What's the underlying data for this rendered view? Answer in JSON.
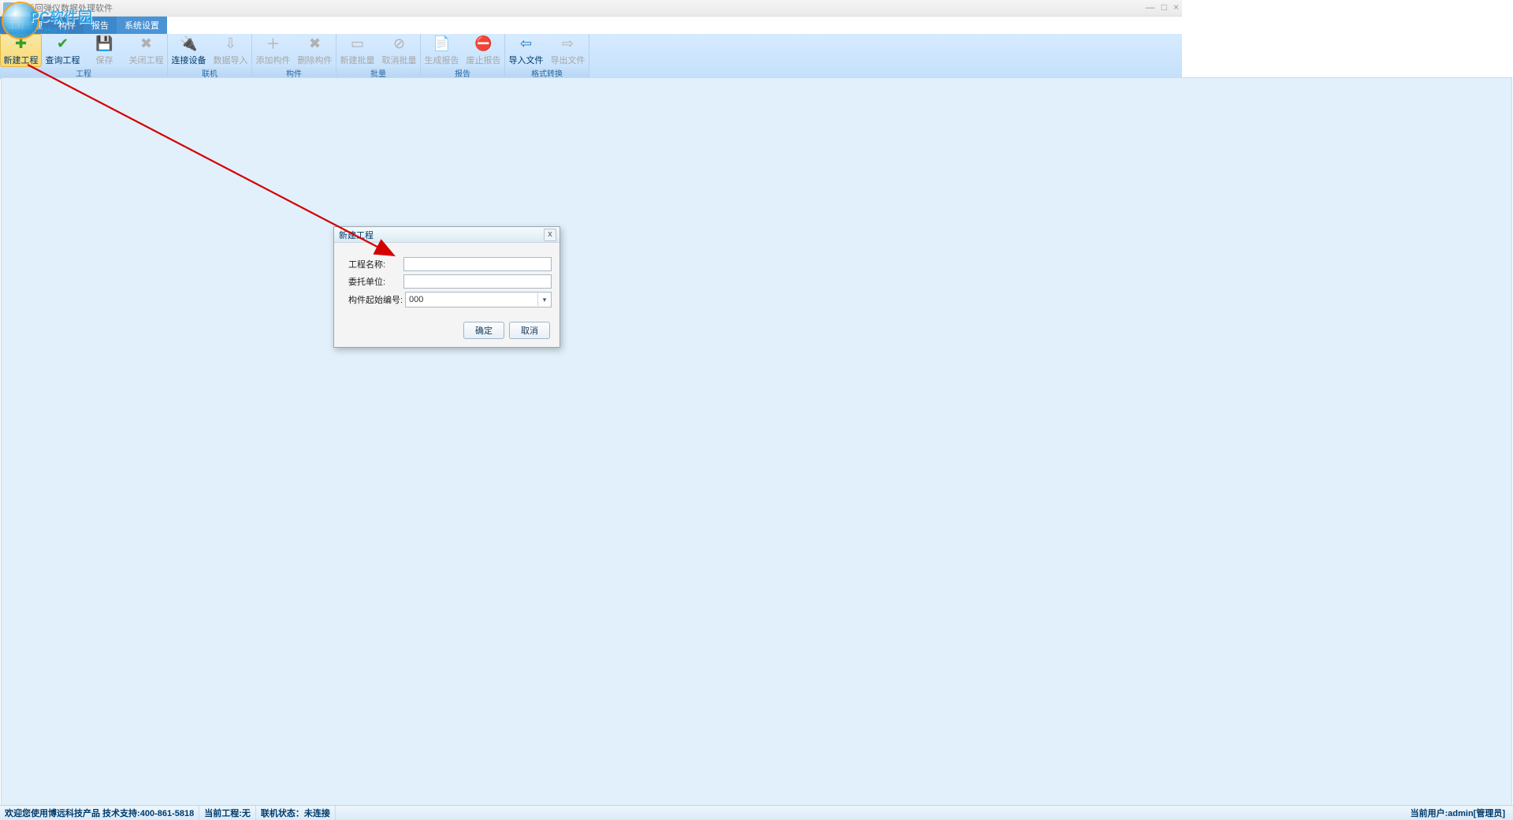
{
  "title": "博远回弹仪数据处理软件",
  "watermark": {
    "text": "PC软件园",
    "url": "www.pc0359.cn"
  },
  "window_buttons": {
    "min": "—",
    "max": "□",
    "close": "×"
  },
  "menu": {
    "m1": "工程管理",
    "m2": "构件",
    "m3": "报告",
    "m4": "系统设置"
  },
  "ribbon": {
    "groups": [
      {
        "label": "工程",
        "buttons": [
          {
            "name": "new-project",
            "label": "新建工程",
            "icon": "✚",
            "cls": "c-green",
            "state": "active"
          },
          {
            "name": "query-project",
            "label": "查询工程",
            "icon": "✔",
            "cls": "c-green",
            "state": "enabled"
          },
          {
            "name": "save",
            "label": "保存",
            "icon": "💾",
            "cls": "c-gray",
            "state": "disabled"
          },
          {
            "name": "close-project",
            "label": "关闭工程",
            "icon": "✖",
            "cls": "c-gray",
            "state": "disabled"
          }
        ]
      },
      {
        "label": "联机",
        "buttons": [
          {
            "name": "connect-device",
            "label": "连接设备",
            "icon": "🔌",
            "cls": "c-blue",
            "state": "enabled"
          },
          {
            "name": "import-data",
            "label": "数据导入",
            "icon": "⇩",
            "cls": "c-gray",
            "state": "disabled"
          }
        ]
      },
      {
        "label": "构件",
        "buttons": [
          {
            "name": "add-member",
            "label": "添加构件",
            "icon": "＋",
            "cls": "c-gray",
            "state": "disabled"
          },
          {
            "name": "delete-member",
            "label": "删除构件",
            "icon": "✖",
            "cls": "c-gray",
            "state": "disabled"
          }
        ]
      },
      {
        "label": "批量",
        "buttons": [
          {
            "name": "new-batch",
            "label": "新建批量",
            "icon": "▭",
            "cls": "c-gray",
            "state": "disabled"
          },
          {
            "name": "cancel-batch",
            "label": "取消批量",
            "icon": "⊘",
            "cls": "c-gray",
            "state": "disabled"
          }
        ]
      },
      {
        "label": "报告",
        "buttons": [
          {
            "name": "gen-report",
            "label": "生成报告",
            "icon": "📄",
            "cls": "c-gray",
            "state": "disabled"
          },
          {
            "name": "stop-report",
            "label": "废止报告",
            "icon": "⛔",
            "cls": "c-gray",
            "state": "disabled"
          }
        ]
      },
      {
        "label": "格式转换",
        "buttons": [
          {
            "name": "import-file",
            "label": "导入文件",
            "icon": "⇦",
            "cls": "c-blue",
            "state": "enabled"
          },
          {
            "name": "export-file",
            "label": "导出文件",
            "icon": "⇨",
            "cls": "c-gray",
            "state": "disabled"
          }
        ]
      }
    ]
  },
  "dialog": {
    "title": "新建工程",
    "fields": {
      "project_name": {
        "label": "工程名称:",
        "value": ""
      },
      "client": {
        "label": "委托单位:",
        "value": ""
      },
      "start_no": {
        "label": "构件起始编号:",
        "value": "000"
      }
    },
    "ok": "确定",
    "cancel": "取消",
    "close": "x"
  },
  "status": {
    "welcome": "欢迎您使用博远科技产品 技术支持:400-861-5818",
    "project_label": "当前工程:",
    "project_value": "无",
    "conn_label": "联机状态：",
    "conn_value": "未连接",
    "user_label": "当前用户:",
    "user_value": "admin[管理员]"
  }
}
